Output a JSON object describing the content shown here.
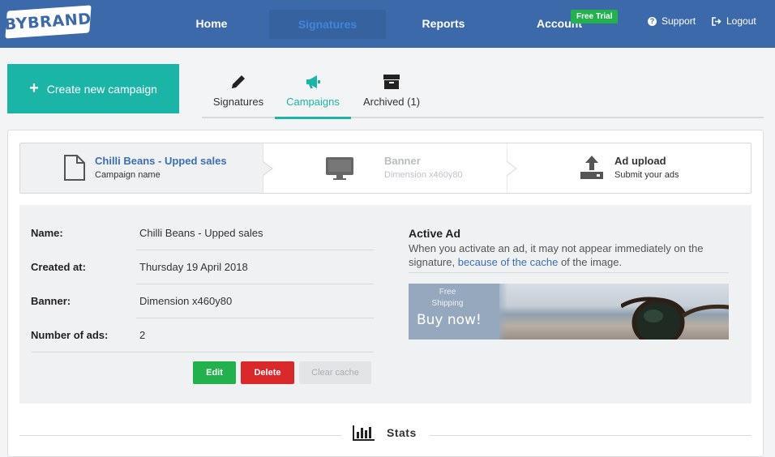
{
  "nav": {
    "logo": "BYBRAND",
    "items": [
      {
        "label": "Home"
      },
      {
        "label": "Signatures"
      },
      {
        "label": "Reports"
      },
      {
        "label": "Account"
      }
    ],
    "badge": "Free Trial",
    "support": "Support",
    "logout": "Logout"
  },
  "create_button": "Create new campaign",
  "tabs": [
    {
      "label": "Signatures",
      "icon": "pencil-icon"
    },
    {
      "label": "Campaigns",
      "icon": "megaphone-icon",
      "active": true
    },
    {
      "label": "Archived (1)",
      "icon": "archive-icon"
    }
  ],
  "steps": [
    {
      "title": "Chilli Beans - Upped sales",
      "subtitle": "Campaign name",
      "icon": "file-icon"
    },
    {
      "title": "Banner",
      "subtitle": "Dimension x460y80",
      "icon": "monitor-icon"
    },
    {
      "title": "Ad upload",
      "subtitle": "Submit your ads",
      "icon": "upload-icon"
    }
  ],
  "details": [
    {
      "label": "Name:",
      "value": "Chilli Beans - Upped sales"
    },
    {
      "label": "Created at:",
      "value": "Thursday 19 April 2018"
    },
    {
      "label": "Banner:",
      "value": "Dimension x460y80"
    },
    {
      "label": "Number of ads:",
      "value": "2"
    }
  ],
  "buttons": {
    "edit": "Edit",
    "delete": "Delete",
    "clear_cache": "Clear cache"
  },
  "active_ad": {
    "title": "Active Ad",
    "desc_before": "When you activate an ad, it may not appear immediately on the signature,",
    "link": "because of the cache",
    "desc_after": "of the image."
  },
  "banner_ad": {
    "line1": "Free",
    "line2": "Shipping",
    "cta": "Buy now!"
  },
  "stats_title": "Stats",
  "colors": {
    "nav": "#3c69a9",
    "accent": "#1ab5a6",
    "edit": "#22b14c",
    "delete": "#d9292b",
    "link": "#3c6fb0"
  }
}
